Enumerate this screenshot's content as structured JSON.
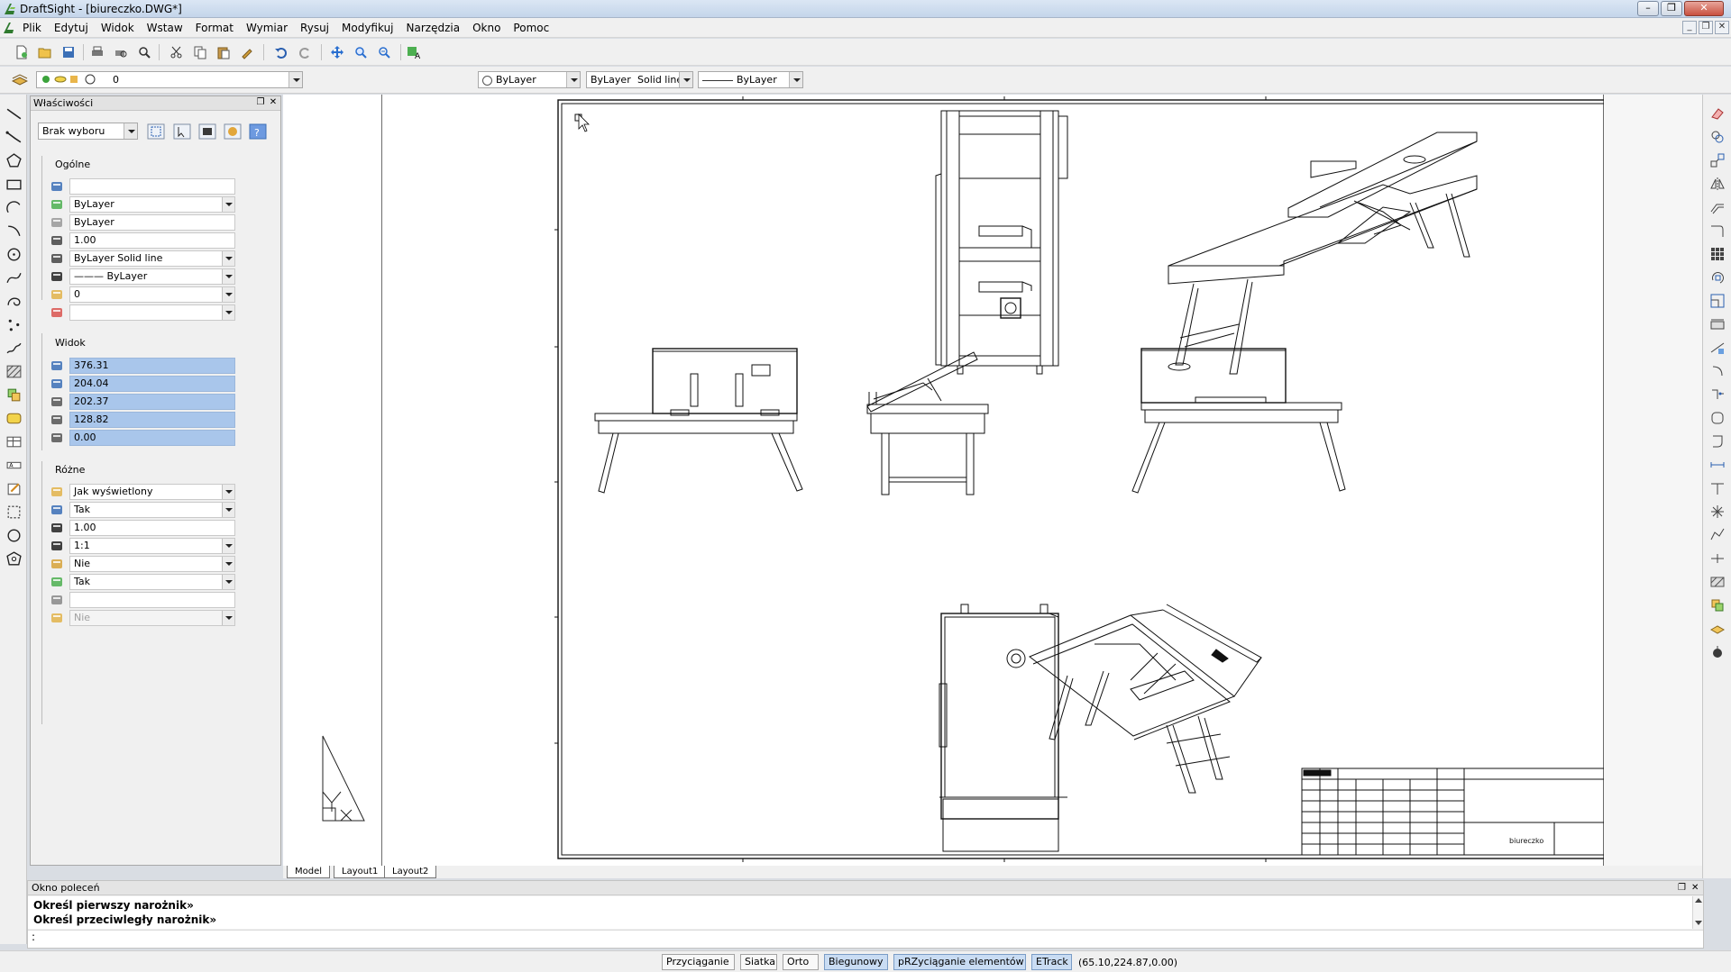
{
  "window": {
    "title": "DraftSight - [biureczko.DWG*]",
    "minimize": "–",
    "restore": "❐",
    "close": "✕"
  },
  "menu": [
    "Plik",
    "Edytuj",
    "Widok",
    "Wstaw",
    "Format",
    "Wymiar",
    "Rysuj",
    "Modyfikuj",
    "Narzędzia",
    "Okno",
    "Pomoc"
  ],
  "layer_toolbar": {
    "layer_value": "0"
  },
  "style_toolbar": {
    "color": "ByLayer",
    "linestyle_layer": "ByLayer",
    "linestyle_name": "Solid line",
    "lineweight": "ByLayer"
  },
  "properties": {
    "panel_title": "Właściwości",
    "selection": "Brak wyboru",
    "general_title": "Ogólne",
    "general": [
      {
        "icon": "color-wheel-icon",
        "value": "",
        "dropdown": false
      },
      {
        "icon": "color-icon",
        "value": "ByLayer",
        "dropdown": true
      },
      {
        "icon": "transparency-icon",
        "value": "ByLayer",
        "dropdown": false
      },
      {
        "icon": "linescale-icon",
        "value": "1.00",
        "dropdown": false
      },
      {
        "icon": "linestyle-icon",
        "value": "ByLayer     Solid line",
        "dropdown": true
      },
      {
        "icon": "lineweight-icon",
        "value": "——— ByLayer",
        "dropdown": true
      },
      {
        "icon": "layer-icon",
        "value": "0",
        "dropdown": true
      },
      {
        "icon": "print-style-icon",
        "value": "",
        "dropdown": true
      }
    ],
    "view_title": "Widok",
    "view": [
      {
        "icon": "width-icon",
        "value": "376.31"
      },
      {
        "icon": "height-icon",
        "value": "204.04"
      },
      {
        "icon": "center-x-icon",
        "value": "202.37"
      },
      {
        "icon": "center-y-icon",
        "value": "128.82"
      },
      {
        "icon": "center-z-icon",
        "value": "0.00"
      }
    ],
    "misc_title": "Różne",
    "misc": [
      {
        "icon": "plot-icon",
        "value": "Jak wyświetlony",
        "dropdown": true
      },
      {
        "icon": "viewport-on-icon",
        "value": "Tak",
        "dropdown": true
      },
      {
        "icon": "xn-scale-icon",
        "value": "1.00",
        "dropdown": false
      },
      {
        "icon": "xn-ratio-icon",
        "value": "1:1",
        "dropdown": true
      },
      {
        "icon": "lock-icon",
        "value": "Nie",
        "dropdown": true
      },
      {
        "icon": "ucs-icon",
        "value": "Tak",
        "dropdown": true
      },
      {
        "icon": "viewport-icon",
        "value": "",
        "dropdown": false
      },
      {
        "icon": "render-icon",
        "value": "Nie",
        "dropdown": true
      }
    ]
  },
  "tabs": [
    "Model",
    "Layout1",
    "Layout2"
  ],
  "title_block": {
    "name": "biureczko"
  },
  "command": {
    "title": "Okno poleceń",
    "lines": [
      "Określ pierwszy narożnik»",
      "Określ przeciwległy narożnik»"
    ],
    "prompt": ":"
  },
  "status": {
    "buttons": [
      {
        "label": "Przyciąganie",
        "on": false
      },
      {
        "label": "Siatka",
        "on": false
      },
      {
        "label": "Orto",
        "on": false
      },
      {
        "label": "Biegunowy",
        "on": true
      },
      {
        "label": "pRZyciąganie elementów",
        "on": true
      },
      {
        "label": "ETrack",
        "on": true
      }
    ],
    "coords": "(65.10,224.87,0.00)"
  },
  "colors": {
    "selection": "#a9c6eb",
    "status_on": "#c9dcf3",
    "accent": "#3b6fb6"
  }
}
